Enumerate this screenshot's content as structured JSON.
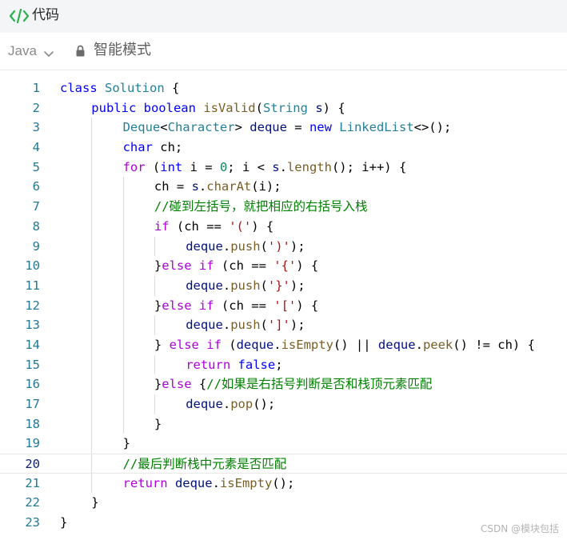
{
  "tab": {
    "label": "代码",
    "icon": "code-brackets-icon"
  },
  "toolbar": {
    "language": "Java",
    "mode": "智能模式"
  },
  "watermark": "CSDN @模块包括",
  "colors": {
    "tab_icon": "#2bb24c",
    "line_number": "#237893",
    "keyword": "#0000ff",
    "type": "#267f99",
    "function": "#795e26",
    "string": "#a31515",
    "number": "#098658",
    "comment": "#008000",
    "control": "#af00db"
  },
  "editor": {
    "active_line": 20,
    "lines": [
      {
        "num": "1",
        "indent": 0,
        "code": "class Solution {"
      },
      {
        "num": "2",
        "indent": 1,
        "code": "public boolean isValid(String s) {"
      },
      {
        "num": "3",
        "indent": 2,
        "code": "Deque<Character> deque = new LinkedList<>();"
      },
      {
        "num": "4",
        "indent": 2,
        "code": "char ch;"
      },
      {
        "num": "5",
        "indent": 2,
        "code": "for (int i = 0; i < s.length(); i++) {"
      },
      {
        "num": "6",
        "indent": 3,
        "code": "ch = s.charAt(i);"
      },
      {
        "num": "7",
        "indent": 3,
        "code": "//碰到左括号，就把相应的右括号入栈"
      },
      {
        "num": "8",
        "indent": 3,
        "code": "if (ch == '(') {"
      },
      {
        "num": "9",
        "indent": 4,
        "code": "deque.push(')');"
      },
      {
        "num": "10",
        "indent": 3,
        "code": "}else if (ch == '{') {"
      },
      {
        "num": "11",
        "indent": 4,
        "code": "deque.push('}');"
      },
      {
        "num": "12",
        "indent": 3,
        "code": "}else if (ch == '[') {"
      },
      {
        "num": "13",
        "indent": 4,
        "code": "deque.push(']');"
      },
      {
        "num": "14",
        "indent": 3,
        "code": "} else if (deque.isEmpty() || deque.peek() != ch) {"
      },
      {
        "num": "15",
        "indent": 4,
        "code": "return false;"
      },
      {
        "num": "16",
        "indent": 3,
        "code": "}else {//如果是右括号判断是否和栈顶元素匹配"
      },
      {
        "num": "17",
        "indent": 4,
        "code": "deque.pop();"
      },
      {
        "num": "18",
        "indent": 3,
        "code": "}"
      },
      {
        "num": "19",
        "indent": 2,
        "code": "}"
      },
      {
        "num": "20",
        "indent": 2,
        "code": "//最后判断栈中元素是否匹配"
      },
      {
        "num": "21",
        "indent": 2,
        "code": "return deque.isEmpty();"
      },
      {
        "num": "22",
        "indent": 1,
        "code": "}"
      },
      {
        "num": "23",
        "indent": 0,
        "code": "}"
      }
    ]
  }
}
